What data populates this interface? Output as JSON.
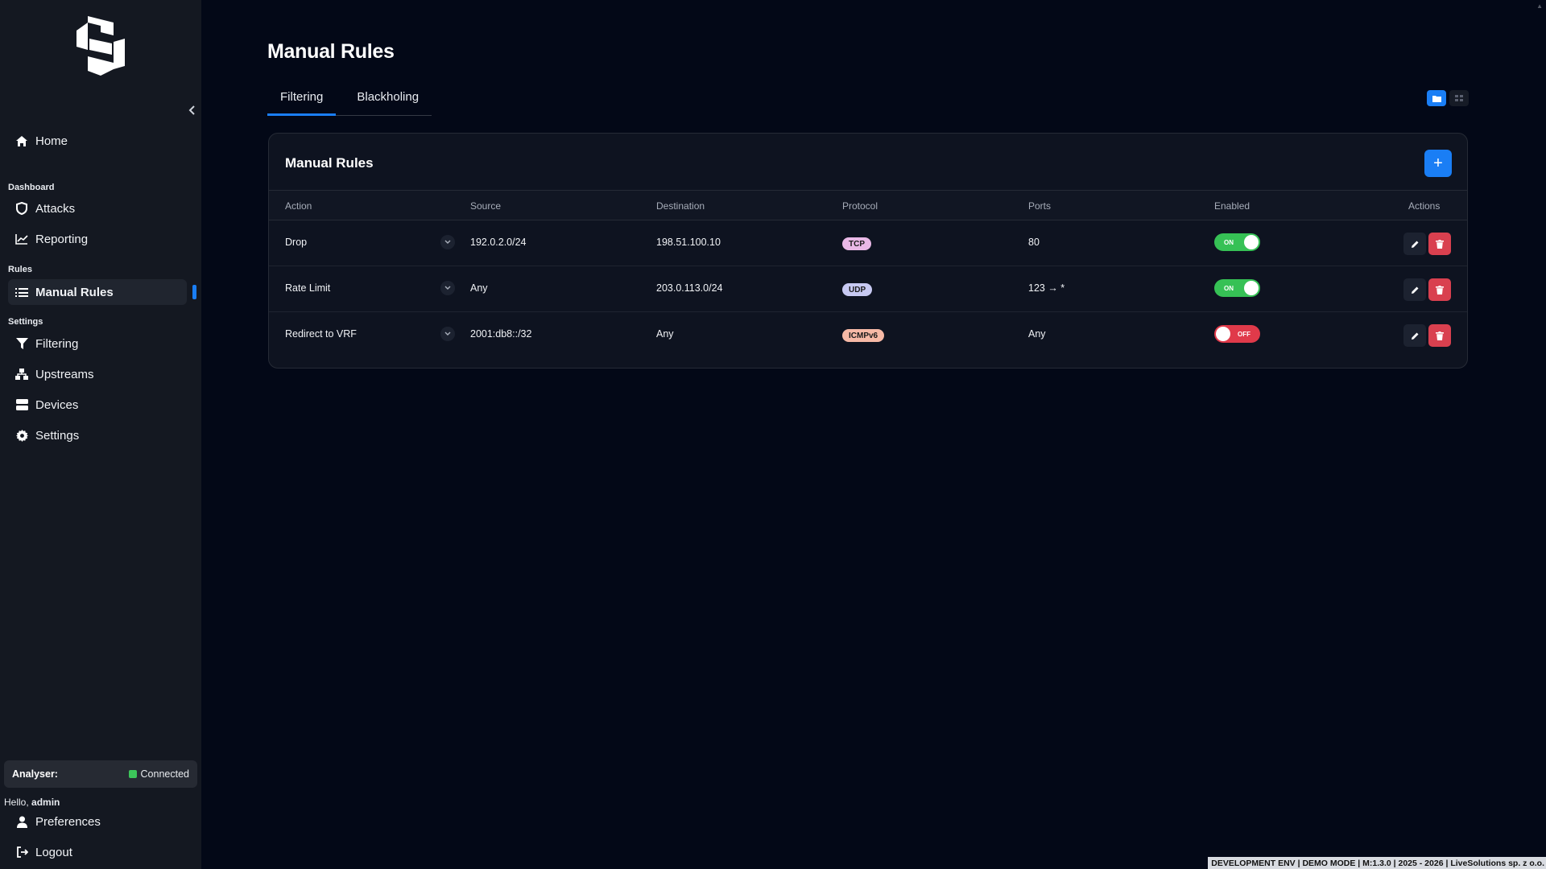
{
  "sidebar": {
    "collapse_icon": "chevron-left-icon",
    "home": "Home",
    "dashboard_section": "Dashboard",
    "attacks": "Attacks",
    "reporting": "Reporting",
    "rules_section": "Rules",
    "manual_rules": "Manual Rules",
    "settings_section": "Settings",
    "filtering": "Filtering",
    "upstreams": "Upstreams",
    "devices": "Devices",
    "settings": "Settings",
    "analyser_label": "Analyser:",
    "analyser_status": "Connected",
    "hello_prefix": "Hello, ",
    "hello_user": "admin",
    "preferences": "Preferences",
    "logout": "Logout"
  },
  "page": {
    "title": "Manual Rules",
    "tabs": [
      "Filtering",
      "Blackholing"
    ],
    "active_tab": "Filtering"
  },
  "card": {
    "title": "Manual Rules",
    "add_label": "+"
  },
  "table": {
    "headers": [
      "Action",
      "Source",
      "Destination",
      "Protocol",
      "Ports",
      "Enabled",
      "Actions"
    ],
    "rows": [
      {
        "action": "Drop",
        "source": "192.0.2.0/24",
        "destination": "198.51.100.10",
        "protocol": "TCP",
        "protocol_color": "#e9b8e6",
        "ports": "80",
        "enabled": true,
        "toggle_label": "ON"
      },
      {
        "action": "Rate Limit",
        "source": "Any",
        "destination": "203.0.113.0/24",
        "protocol": "UDP",
        "protocol_color": "#c7c9f2",
        "ports": "123 → *",
        "enabled": true,
        "toggle_label": "ON"
      },
      {
        "action": "Redirect to VRF",
        "source": "2001:db8::/32",
        "destination": "Any",
        "protocol": "ICMPv6",
        "protocol_color": "#f6b9a6",
        "ports": "Any",
        "enabled": false,
        "toggle_label": "OFF"
      }
    ]
  },
  "footer": {
    "text": "DEVELOPMENT ENV | DEMO MODE | M:1.3.0 | 2025 - 2026 | LiveSolutions sp. z o.o."
  },
  "colors": {
    "accent": "#1a7ef5",
    "on": "#36c155",
    "off": "#e03a4a",
    "delete": "#d9404f",
    "connected": "#3cc55a"
  }
}
